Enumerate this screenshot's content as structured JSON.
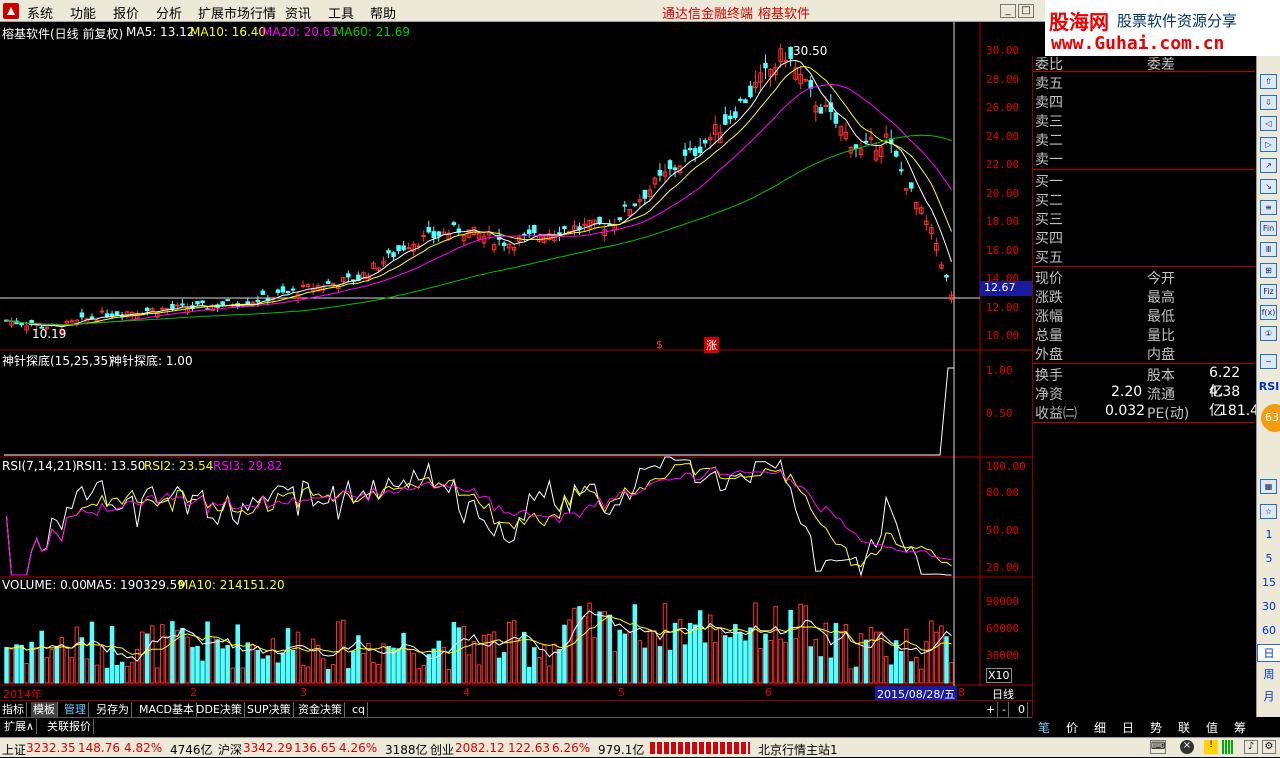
{
  "menu": [
    "系统",
    "功能",
    "报价",
    "分析",
    "扩展市场行情",
    "资讯",
    "工具",
    "帮助"
  ],
  "window_title": "通达信金融终端",
  "window_stock": "榕基软件",
  "brand": {
    "name": "股海网",
    "tagline": "股票软件资源分享",
    "url": "www.Guhai.com.cn"
  },
  "main_chart": {
    "title": "榕基软件(日线 前复权)",
    "ma5": "MA5: 13.12",
    "ma10": "MA10: 16.40",
    "ma20": "MA20: 20.61",
    "ma60": "MA60: 21.69",
    "high_label": "30.50",
    "low_label": "10.19",
    "current_price": "12.67",
    "y_ticks": [
      "30.00",
      "28.00",
      "26.00",
      "24.00",
      "22.00",
      "20.00",
      "18.00",
      "16.00",
      "14.00",
      "12.00",
      "10.00"
    ],
    "marker_s": "$",
    "marker_zhang": "涨"
  },
  "indicator1": {
    "title": "神针探底(15,25,35)",
    "value": "神针探底: 1.00",
    "ticks": [
      "1.00",
      "0.50"
    ]
  },
  "rsi": {
    "title": "RSI(7,14,21)",
    "rsi1": "RSI1: 13.50",
    "rsi2": "RSI2: 23.54",
    "rsi3": "RSI3: 29.82",
    "ticks": [
      "100.00",
      "80.00",
      "50.00",
      "20.00"
    ]
  },
  "volume": {
    "title": "VOLUME: 0.00",
    "ma5": "MA5: 190329.59",
    "ma10": "MA10: 214151.20",
    "ticks": [
      "90000",
      "60000",
      "30000"
    ],
    "unit": "X10"
  },
  "timeline": {
    "year": "2014年",
    "months": [
      "2",
      "3",
      "4",
      "5",
      "6"
    ],
    "cursor_date": "2015/08/28/五",
    "end": "8",
    "period": "日线"
  },
  "tabs": [
    "指标",
    "模板",
    "管理",
    "另存为",
    "MACD基本",
    "DDE决策",
    "SUP决策",
    "资金决策",
    "cq"
  ],
  "zoom_ctrl": [
    "+",
    "-",
    "0"
  ],
  "tabs2": [
    "扩展∧",
    "关联报价"
  ],
  "right_panel": {
    "weibi_label": "委比",
    "weicha_label": "委差",
    "sell": [
      "卖五",
      "卖四",
      "卖三",
      "卖二",
      "卖一"
    ],
    "buy": [
      "买一",
      "买二",
      "买三",
      "买四",
      "买五"
    ],
    "left_col": [
      "现价",
      "涨跌",
      "涨幅",
      "总量",
      "外盘"
    ],
    "right_col": [
      "今开",
      "最高",
      "最低",
      "量比",
      "内盘"
    ],
    "fin": [
      {
        "l": "换手",
        "v": "",
        "l2": "股本",
        "v2": "6.22亿"
      },
      {
        "l": "净资",
        "v": "2.20",
        "l2": "流通",
        "v2": "4.38亿"
      },
      {
        "l": "收益㈡",
        "v": "0.032",
        "l2": "PE(动)",
        "v2": "181.4"
      }
    ]
  },
  "bottom_tabs": [
    "笔",
    "价",
    "细",
    "日",
    "势",
    "联",
    "值",
    "筹"
  ],
  "toolbar": {
    "icons": [
      "arrow-up-icon",
      "arrow-down-icon",
      "left-icon",
      "right-icon",
      "chart-icon",
      "line-icon",
      "bar-icon",
      "fin-icon",
      "news-icon",
      "tree-icon",
      "fiz-icon",
      "fx-icon",
      "info-icon"
    ],
    "icon_text": [
      "⇧",
      "⇩",
      "◁",
      "▷",
      "↗",
      "↘",
      "≡",
      "Fin",
      "Ⅲ",
      "⊞",
      "Fiz",
      "f(x)",
      "①"
    ],
    "rsi": "RSI",
    "badge": "63",
    "nums": [
      "1",
      "5",
      "15",
      "30",
      "60",
      "日",
      "周",
      "月"
    ]
  },
  "status": {
    "sh_label": "上证",
    "sh_index": "3232.35",
    "sh_chg": "148.76",
    "sh_pct": "4.82%",
    "sh_amt": "4746亿",
    "sz_label": "沪深",
    "sz_index": "3342.29",
    "sz_chg": "136.65",
    "sz_pct": "4.26%",
    "sz_amt": "3188亿",
    "cy_label": "创业",
    "cy_index": "2082.12",
    "cy_chg": "122.63",
    "cy_pct": "6.26%",
    "cy_amt": "979.1亿",
    "server": "北京行情主站1"
  },
  "colors": {
    "up": "#ff3232",
    "down": "#54ffff",
    "ma5": "#ffffff",
    "ma10": "#ffff00",
    "ma20": "#ff00ff",
    "ma60": "#00c000",
    "grid": "#b00000"
  },
  "chart_data": {
    "type": "candlestick",
    "title": "榕基软件(日线 前复权)",
    "ylim": [
      9.2,
      31.2
    ],
    "anchors_close": [
      [
        0,
        11.0
      ],
      [
        10,
        10.5
      ],
      [
        20,
        11.5
      ],
      [
        30,
        11.8
      ],
      [
        40,
        12.0
      ],
      [
        50,
        12.5
      ],
      [
        60,
        13.3
      ],
      [
        70,
        14.0
      ],
      [
        80,
        16.5
      ],
      [
        90,
        17.5
      ],
      [
        95,
        17.0
      ],
      [
        100,
        16.5
      ],
      [
        110,
        17.5
      ],
      [
        120,
        17.8
      ],
      [
        130,
        21.0
      ],
      [
        140,
        24.0
      ],
      [
        150,
        28.0
      ],
      [
        155,
        30.0
      ],
      [
        160,
        27.0
      ],
      [
        165,
        25.0
      ],
      [
        170,
        23.0
      ],
      [
        175,
        24.0
      ],
      [
        180,
        20.0
      ],
      [
        185,
        16.5
      ],
      [
        188,
        12.67
      ]
    ]
  }
}
